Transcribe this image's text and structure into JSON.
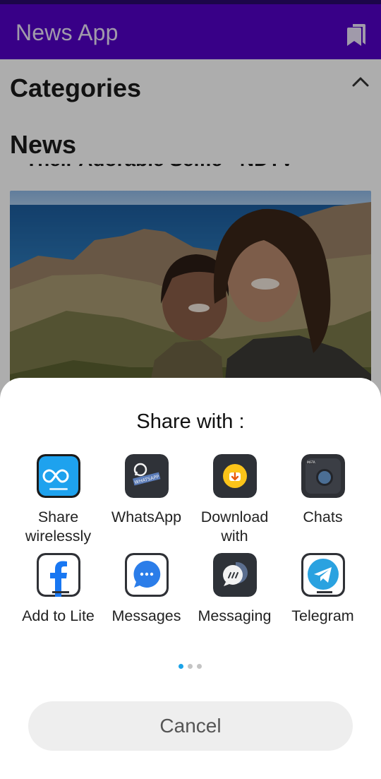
{
  "app_bar": {
    "title": "News App",
    "bookmark_icon": "bookmarks-icon",
    "color": "#5300c8"
  },
  "content": {
    "categories_label": "Categories",
    "news_label": "News",
    "partial_headline": "Their Adorable Selfie - NDTV",
    "image_icon": "news-photo"
  },
  "share_sheet": {
    "title": "Share with :",
    "targets": [
      {
        "label": "Share wirelessly",
        "icon": "share-wirelessly-icon"
      },
      {
        "label": "WhatsApp",
        "icon": "whatsapp-icon"
      },
      {
        "label": "Download with",
        "icon": "download-icon"
      },
      {
        "label": "Chats",
        "icon": "chats-icon"
      },
      {
        "label": "Add to Lite",
        "icon": "facebook-lite-icon"
      },
      {
        "label": "Messages",
        "icon": "messages-icon"
      },
      {
        "label": "Messaging",
        "icon": "messaging-icon"
      },
      {
        "label": "Telegram",
        "icon": "telegram-icon"
      }
    ],
    "pagination": {
      "pages": 3,
      "current": 1,
      "active_color": "#1aa3e8",
      "inactive_color": "#c4c4c4"
    },
    "cancel_label": "Cancel"
  }
}
